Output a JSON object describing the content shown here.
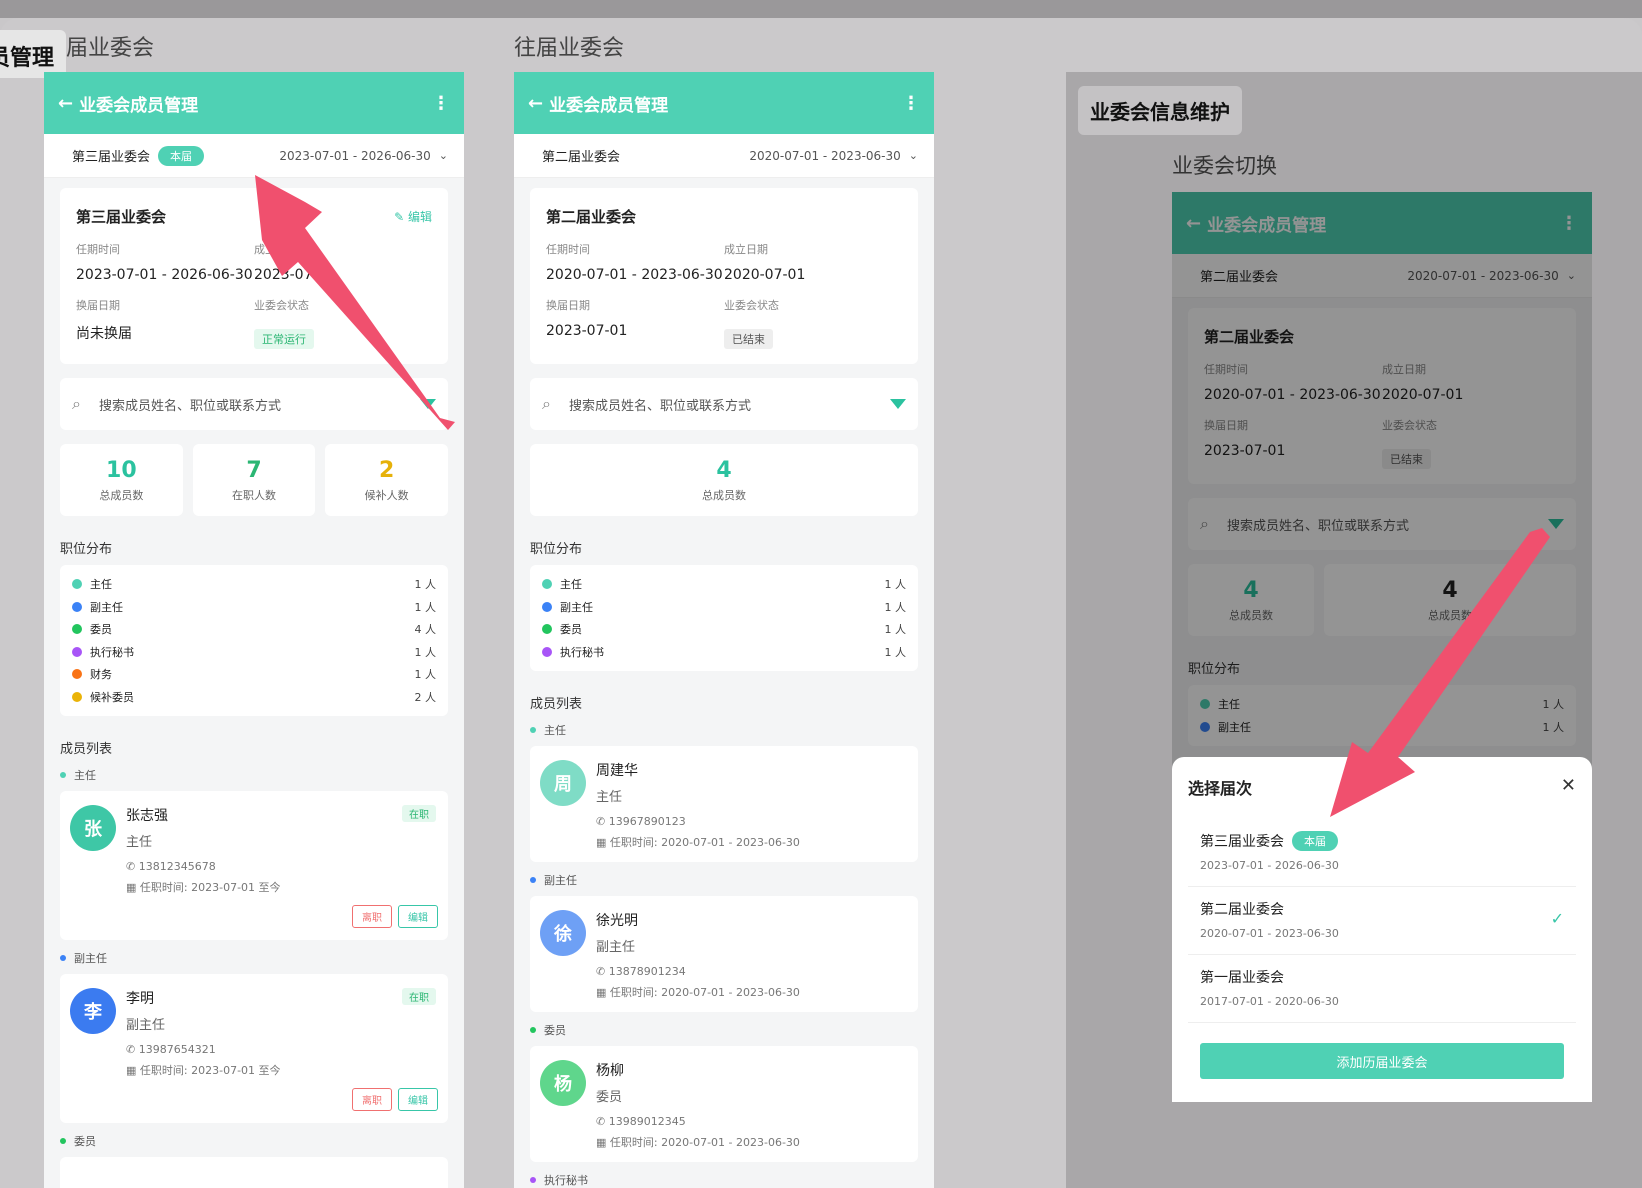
{
  "tag_left": "员管理",
  "frame1_title": "届业委会",
  "frame2_title": "往届业委会",
  "right_label": "业委会信息维护",
  "right_sub": "业委会切换",
  "app_title": "业委会成员管理",
  "search_placeholder": "搜索成员姓名、职位或联系方式",
  "sec_dist": "职位分布",
  "sec_members": "成员列表",
  "phone1": {
    "selector_name": "第三届业委会",
    "selector_badge": "本届",
    "selector_date": "2023-07-01 - 2026-06-30",
    "card_title": "第三届业委会",
    "edit": "编辑",
    "term_label": "任期时间",
    "term_value": "2023-07-01 - 2026-06-30",
    "found_label": "成立日期",
    "found_value": "2023-07-01",
    "change_label": "换届日期",
    "change_value": "尚未换届",
    "status_label": "业委会状态",
    "status_value": "正常运行",
    "stats": [
      {
        "n": "10",
        "t": "总成员数",
        "color": "#2bc29f"
      },
      {
        "n": "7",
        "t": "在职人数",
        "color": "#2bb673"
      },
      {
        "n": "2",
        "t": "候补人数",
        "color": "#e6b10a"
      }
    ],
    "dist": [
      {
        "name": "主任",
        "cnt": "1 人",
        "color": "#4fd1b4"
      },
      {
        "name": "副主任",
        "cnt": "1 人",
        "color": "#3b82f6"
      },
      {
        "name": "委员",
        "cnt": "4 人",
        "color": "#22c55e"
      },
      {
        "name": "执行秘书",
        "cnt": "1 人",
        "color": "#a855f7"
      },
      {
        "name": "财务",
        "cnt": "1 人",
        "color": "#f97316"
      },
      {
        "name": "候补委员",
        "cnt": "2 人",
        "color": "#eab308"
      }
    ],
    "groups": [
      {
        "label": "主任",
        "color": "#4fd1b4",
        "avatar": "张",
        "avatar_color": "#3ec7a6",
        "name": "张志强",
        "role": "主任",
        "phone": "13812345678",
        "term": "任职时间: 2023-07-01 至今",
        "state": "在职",
        "btn_out": "离职",
        "btn_edit": "编辑"
      },
      {
        "label": "副主任",
        "color": "#3b82f6",
        "avatar": "李",
        "avatar_color": "#3b7bf0",
        "name": "李明",
        "role": "副主任",
        "phone": "13987654321",
        "term": "任职时间: 2023-07-01 至今",
        "state": "在职",
        "btn_out": "离职",
        "btn_edit": "编辑"
      }
    ],
    "group3_label": "委员"
  },
  "phone2": {
    "selector_name": "第二届业委会",
    "selector_date": "2020-07-01 - 2023-06-30",
    "card_title": "第二届业委会",
    "term_label": "任期时间",
    "term_value": "2020-07-01 - 2023-06-30",
    "found_label": "成立日期",
    "found_value": "2020-07-01",
    "change_label": "换届日期",
    "change_value": "2023-07-01",
    "status_label": "业委会状态",
    "status_value": "已结束",
    "stat_n": "4",
    "stat_t": "总成员数",
    "dist": [
      {
        "name": "主任",
        "cnt": "1 人",
        "color": "#4fd1b4"
      },
      {
        "name": "副主任",
        "cnt": "1 人",
        "color": "#3b82f6"
      },
      {
        "name": "委员",
        "cnt": "1 人",
        "color": "#22c55e"
      },
      {
        "name": "执行秘书",
        "cnt": "1 人",
        "color": "#a855f7"
      }
    ],
    "groups": [
      {
        "label": "主任",
        "color": "#4fd1b4",
        "avatar": "周",
        "avatar_color": "#7fdcc6",
        "name": "周建华",
        "role": "主任",
        "phone": "13967890123",
        "term": "任职时间: 2020-07-01 - 2023-06-30"
      },
      {
        "label": "副主任",
        "color": "#3b82f6",
        "avatar": "徐",
        "avatar_color": "#6ea0f5",
        "name": "徐光明",
        "role": "副主任",
        "phone": "13878901234",
        "term": "任职时间: 2020-07-01 - 2023-06-30"
      },
      {
        "label": "委员",
        "color": "#22c55e",
        "avatar": "杨",
        "avatar_color": "#5fd68c",
        "name": "杨柳",
        "role": "委员",
        "phone": "13989012345",
        "term": "任职时间: 2020-07-01 - 2023-06-30"
      }
    ],
    "group4_label": "执行秘书"
  },
  "phone3": {
    "selector_name": "第二届业委会",
    "selector_date": "2020-07-01 - 2023-06-30",
    "card_title": "第二届业委会",
    "term_label": "任期时间",
    "term_value": "2020-07-01 - 2023-06-30",
    "found_label": "成立日期",
    "found_value": "2020-07-01",
    "change_label": "换届日期",
    "change_value": "2023-07-01",
    "status_label": "业委会状态",
    "status_value": "已结束",
    "stat1_n": "4",
    "stat1_t": "总成员数",
    "stat2_n": "4",
    "stat2_t": "总成员数",
    "dist": [
      {
        "name": "主任",
        "cnt": "1 人",
        "color": "#4fd1b4"
      },
      {
        "name": "副主任",
        "cnt": "1 人",
        "color": "#3b82f6"
      }
    ]
  },
  "sheet": {
    "title": "选择届次",
    "options": [
      {
        "name": "第三届业委会",
        "badge": "本届",
        "date": "2023-07-01 - 2026-06-30"
      },
      {
        "name": "第二届业委会",
        "date": "2020-07-01 - 2023-06-30",
        "selected": true
      },
      {
        "name": "第一届业委会",
        "date": "2017-07-01 - 2020-06-30"
      }
    ],
    "add_button": "添加历届业委会"
  },
  "colors": {
    "primary": "#4fd1b4",
    "arrow": "#f0506e"
  }
}
